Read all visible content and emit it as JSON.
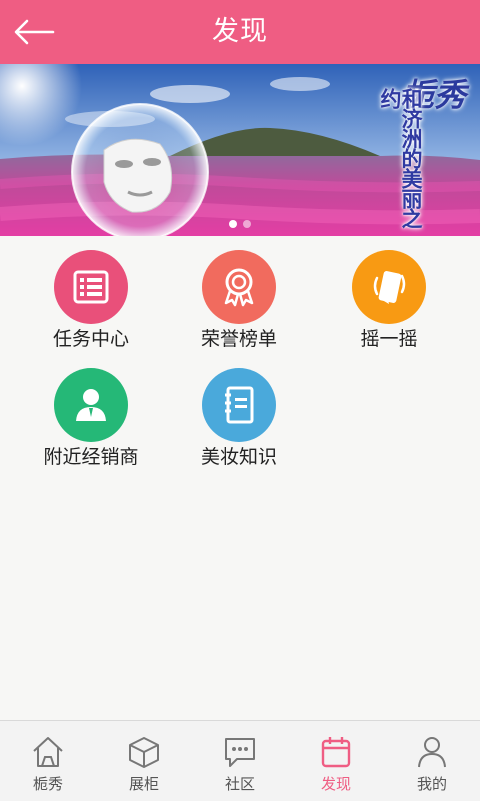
{
  "header": {
    "title": "发现",
    "back_icon": "arrow-left-icon"
  },
  "banner": {
    "brand": "栀秀",
    "slogan": "和济洲的美丽之约",
    "page_index": 1,
    "page_count": 2
  },
  "features": [
    {
      "label": "任务中心",
      "icon": "task-list-icon",
      "color": "#e9507a"
    },
    {
      "label": "荣誉榜单",
      "icon": "award-ribbon-icon",
      "color": "#f16b5e"
    },
    {
      "label": "摇一摇",
      "icon": "shake-phone-icon",
      "color": "#f89a13"
    },
    {
      "label": "附近经销商",
      "icon": "dealer-person-icon",
      "color": "#25b877"
    },
    {
      "label": "美妆知识",
      "icon": "notebook-icon",
      "color": "#4aa9db"
    }
  ],
  "tabbar": {
    "active": "发现",
    "tabs": [
      {
        "label": "栀秀",
        "icon": "home-icon"
      },
      {
        "label": "展柜",
        "icon": "box-icon"
      },
      {
        "label": "社区",
        "icon": "chat-bubble-icon"
      },
      {
        "label": "发现",
        "icon": "calendar-icon"
      },
      {
        "label": "我的",
        "icon": "user-icon"
      }
    ]
  },
  "colors": {
    "accent": "#ef5d83",
    "background": "#f7f7f5"
  }
}
